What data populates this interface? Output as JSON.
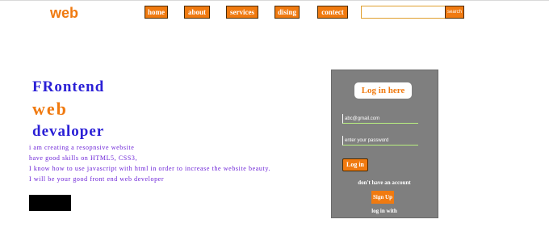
{
  "brand": {
    "logo": "web"
  },
  "nav": {
    "items": [
      {
        "label": "home"
      },
      {
        "label": "about"
      },
      {
        "label": "services"
      },
      {
        "label": "dising"
      },
      {
        "label": "contect"
      }
    ],
    "search_button": "search"
  },
  "hero": {
    "line1": "FRontend",
    "line2": "web",
    "line3": "devaloper",
    "description": [
      "i am creating a resopnsive website",
      "have good skills on HTML5, CSS3,",
      "I know how to use javascript with html in order to increase the website beauty.",
      "I will be your good front end web developer"
    ]
  },
  "login": {
    "title": "Log in here",
    "email_value": "abc@gmail.com",
    "password_placeholder": "enter your password",
    "login_button": "Log in",
    "no_account": "don't have an account",
    "signup_button": "Sign Up",
    "login_with": "log in with"
  },
  "colors": {
    "accent": "#f07a10",
    "headline_blue": "#2a1fd6",
    "description_purple": "#6a1fd6",
    "panel_gray": "#7f7f7f"
  }
}
